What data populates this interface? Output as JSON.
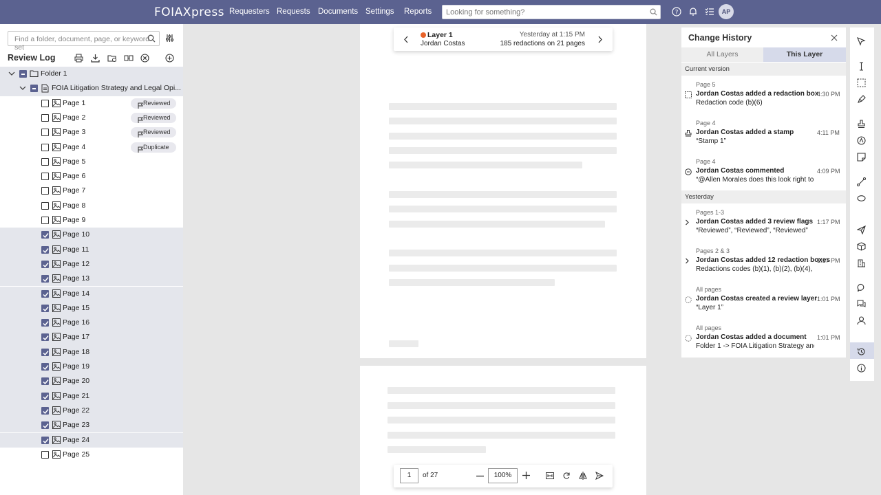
{
  "topbar": {
    "logo": "FOIAXpress",
    "nav": [
      "Requesters",
      "Requests",
      "Documents",
      "Settings",
      "Reports"
    ],
    "search_placeholder": "Looking for something?",
    "avatar_initials": "AP"
  },
  "left_panel": {
    "search_placeholder": "Find a folder, document, page, or keyword set",
    "title": "Review Log",
    "folder": "Folder 1",
    "document": "FOIA Litigation Strategy and Legal Opi...",
    "pages": [
      {
        "label": "Page 1",
        "checked": false,
        "badge": "Reviewed"
      },
      {
        "label": "Page 2",
        "checked": false,
        "badge": "Reviewed"
      },
      {
        "label": "Page 3",
        "checked": false,
        "badge": "Reviewed"
      },
      {
        "label": "Page 4",
        "checked": false,
        "badge": "Duplicate"
      },
      {
        "label": "Page 5",
        "checked": false,
        "badge": ""
      },
      {
        "label": "Page 6",
        "checked": false,
        "badge": ""
      },
      {
        "label": "Page 7",
        "checked": false,
        "badge": ""
      },
      {
        "label": "Page 8",
        "checked": false,
        "badge": ""
      },
      {
        "label": "Page 9",
        "checked": false,
        "badge": ""
      },
      {
        "label": "Page 10",
        "checked": true,
        "badge": ""
      },
      {
        "label": "Page 11",
        "checked": true,
        "badge": ""
      },
      {
        "label": "Page 12",
        "checked": true,
        "badge": ""
      },
      {
        "label": "Page 13",
        "checked": true,
        "badge": ""
      },
      {
        "label": "Page 14",
        "checked": true,
        "badge": ""
      },
      {
        "label": "Page 15",
        "checked": true,
        "badge": ""
      },
      {
        "label": "Page 16",
        "checked": true,
        "badge": ""
      },
      {
        "label": "Page 17",
        "checked": true,
        "badge": ""
      },
      {
        "label": "Page 18",
        "checked": true,
        "badge": ""
      },
      {
        "label": "Page 19",
        "checked": true,
        "badge": ""
      },
      {
        "label": "Page 20",
        "checked": true,
        "badge": ""
      },
      {
        "label": "Page 21",
        "checked": true,
        "badge": ""
      },
      {
        "label": "Page 22",
        "checked": true,
        "badge": ""
      },
      {
        "label": "Page 23",
        "checked": true,
        "badge": ""
      },
      {
        "label": "Page 24",
        "checked": true,
        "badge": ""
      },
      {
        "label": "Page 25",
        "checked": false,
        "badge": ""
      }
    ]
  },
  "layer_popup": {
    "layer_name": "Layer 1",
    "author": "Jordan Costas",
    "timestamp": "Yesterday at 1:15 PM",
    "summary": "185 redactions on 21 pages",
    "dot_color": "#e8632a"
  },
  "viewer_bar": {
    "page": "1",
    "of_total": "of 27",
    "zoom": "100%"
  },
  "change_history": {
    "title": "Change History",
    "tabs": [
      "All Layers",
      "This Layer"
    ],
    "active_tab": "This Layer",
    "section_current": "Current version",
    "section_yesterday": "Yesterday",
    "current_entries": [
      {
        "page": "Page 5",
        "title": "Jordan Costas added a redaction box",
        "detail": "Redaction code (b)(6)",
        "time": "4:30 PM",
        "icon": "redaction-box-icon"
      },
      {
        "page": "Page 4",
        "title": "Jordan Costas added a stamp",
        "detail": "“Stamp 1”",
        "time": "4:11 PM",
        "icon": "stamp-icon"
      },
      {
        "page": "Page 4",
        "title": "Jordan Costas commented",
        "detail": "“@Allen Morales does this look right to y...”",
        "time": "4:09 PM",
        "icon": "comment-icon"
      }
    ],
    "yesterday_entries": [
      {
        "page": "Pages 1-3",
        "title": "Jordan Costas added 3 review flags",
        "detail": "“Reviewed”, “Reviewed”, “Reviewed”",
        "time": "1:17 PM",
        "icon": "chevron-right-icon"
      },
      {
        "page": "Pages 2 & 3",
        "title": "Jordan Costas added 12 redaction boxes",
        "detail": "Redactions codes (b)(1), (b)(2), (b)(4), (b)(...",
        "time": "1:17 PM",
        "icon": "chevron-right-icon"
      },
      {
        "page": "All pages",
        "title": "Jordan Costas created a review layer",
        "detail": "“Layer 1”",
        "time": "1:01 PM",
        "icon": "dashed-circle-icon"
      },
      {
        "page": "All pages",
        "title": "Jordan Costas added a document",
        "detail": "Folder 1 -> FOIA Litigation Strategy and ...",
        "time": "1:01 PM",
        "icon": "dashed-circle-icon"
      }
    ]
  }
}
